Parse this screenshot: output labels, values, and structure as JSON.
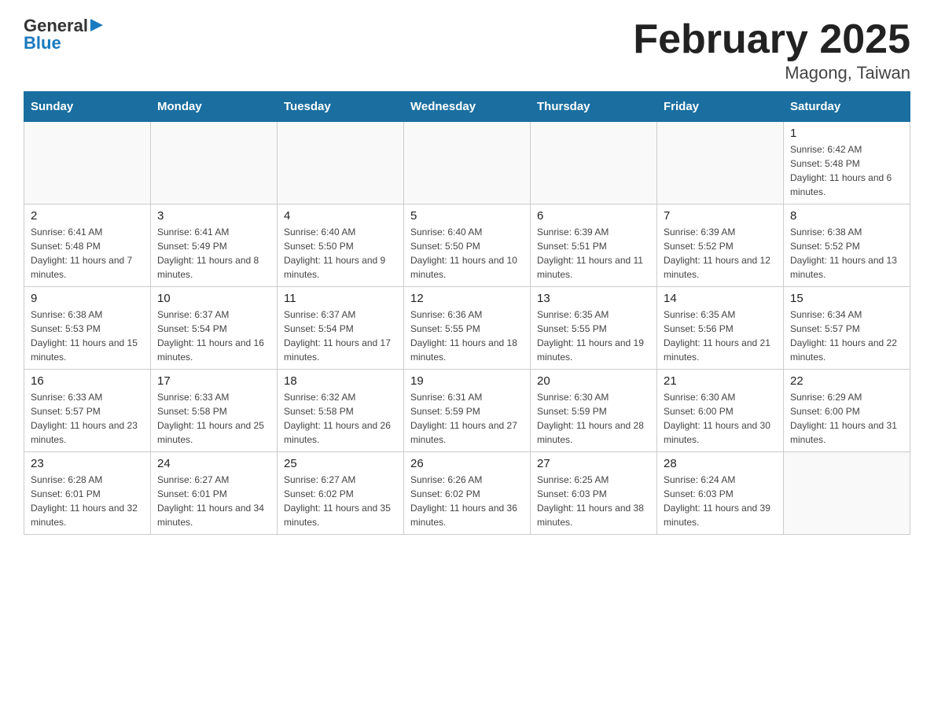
{
  "header": {
    "logo_general": "General",
    "logo_blue": "Blue",
    "title": "February 2025",
    "subtitle": "Magong, Taiwan"
  },
  "days_of_week": [
    "Sunday",
    "Monday",
    "Tuesday",
    "Wednesday",
    "Thursday",
    "Friday",
    "Saturday"
  ],
  "weeks": [
    [
      {
        "day": "",
        "info": ""
      },
      {
        "day": "",
        "info": ""
      },
      {
        "day": "",
        "info": ""
      },
      {
        "day": "",
        "info": ""
      },
      {
        "day": "",
        "info": ""
      },
      {
        "day": "",
        "info": ""
      },
      {
        "day": "1",
        "info": "Sunrise: 6:42 AM\nSunset: 5:48 PM\nDaylight: 11 hours and 6 minutes."
      }
    ],
    [
      {
        "day": "2",
        "info": "Sunrise: 6:41 AM\nSunset: 5:48 PM\nDaylight: 11 hours and 7 minutes."
      },
      {
        "day": "3",
        "info": "Sunrise: 6:41 AM\nSunset: 5:49 PM\nDaylight: 11 hours and 8 minutes."
      },
      {
        "day": "4",
        "info": "Sunrise: 6:40 AM\nSunset: 5:50 PM\nDaylight: 11 hours and 9 minutes."
      },
      {
        "day": "5",
        "info": "Sunrise: 6:40 AM\nSunset: 5:50 PM\nDaylight: 11 hours and 10 minutes."
      },
      {
        "day": "6",
        "info": "Sunrise: 6:39 AM\nSunset: 5:51 PM\nDaylight: 11 hours and 11 minutes."
      },
      {
        "day": "7",
        "info": "Sunrise: 6:39 AM\nSunset: 5:52 PM\nDaylight: 11 hours and 12 minutes."
      },
      {
        "day": "8",
        "info": "Sunrise: 6:38 AM\nSunset: 5:52 PM\nDaylight: 11 hours and 13 minutes."
      }
    ],
    [
      {
        "day": "9",
        "info": "Sunrise: 6:38 AM\nSunset: 5:53 PM\nDaylight: 11 hours and 15 minutes."
      },
      {
        "day": "10",
        "info": "Sunrise: 6:37 AM\nSunset: 5:54 PM\nDaylight: 11 hours and 16 minutes."
      },
      {
        "day": "11",
        "info": "Sunrise: 6:37 AM\nSunset: 5:54 PM\nDaylight: 11 hours and 17 minutes."
      },
      {
        "day": "12",
        "info": "Sunrise: 6:36 AM\nSunset: 5:55 PM\nDaylight: 11 hours and 18 minutes."
      },
      {
        "day": "13",
        "info": "Sunrise: 6:35 AM\nSunset: 5:55 PM\nDaylight: 11 hours and 19 minutes."
      },
      {
        "day": "14",
        "info": "Sunrise: 6:35 AM\nSunset: 5:56 PM\nDaylight: 11 hours and 21 minutes."
      },
      {
        "day": "15",
        "info": "Sunrise: 6:34 AM\nSunset: 5:57 PM\nDaylight: 11 hours and 22 minutes."
      }
    ],
    [
      {
        "day": "16",
        "info": "Sunrise: 6:33 AM\nSunset: 5:57 PM\nDaylight: 11 hours and 23 minutes."
      },
      {
        "day": "17",
        "info": "Sunrise: 6:33 AM\nSunset: 5:58 PM\nDaylight: 11 hours and 25 minutes."
      },
      {
        "day": "18",
        "info": "Sunrise: 6:32 AM\nSunset: 5:58 PM\nDaylight: 11 hours and 26 minutes."
      },
      {
        "day": "19",
        "info": "Sunrise: 6:31 AM\nSunset: 5:59 PM\nDaylight: 11 hours and 27 minutes."
      },
      {
        "day": "20",
        "info": "Sunrise: 6:30 AM\nSunset: 5:59 PM\nDaylight: 11 hours and 28 minutes."
      },
      {
        "day": "21",
        "info": "Sunrise: 6:30 AM\nSunset: 6:00 PM\nDaylight: 11 hours and 30 minutes."
      },
      {
        "day": "22",
        "info": "Sunrise: 6:29 AM\nSunset: 6:00 PM\nDaylight: 11 hours and 31 minutes."
      }
    ],
    [
      {
        "day": "23",
        "info": "Sunrise: 6:28 AM\nSunset: 6:01 PM\nDaylight: 11 hours and 32 minutes."
      },
      {
        "day": "24",
        "info": "Sunrise: 6:27 AM\nSunset: 6:01 PM\nDaylight: 11 hours and 34 minutes."
      },
      {
        "day": "25",
        "info": "Sunrise: 6:27 AM\nSunset: 6:02 PM\nDaylight: 11 hours and 35 minutes."
      },
      {
        "day": "26",
        "info": "Sunrise: 6:26 AM\nSunset: 6:02 PM\nDaylight: 11 hours and 36 minutes."
      },
      {
        "day": "27",
        "info": "Sunrise: 6:25 AM\nSunset: 6:03 PM\nDaylight: 11 hours and 38 minutes."
      },
      {
        "day": "28",
        "info": "Sunrise: 6:24 AM\nSunset: 6:03 PM\nDaylight: 11 hours and 39 minutes."
      },
      {
        "day": "",
        "info": ""
      }
    ]
  ]
}
